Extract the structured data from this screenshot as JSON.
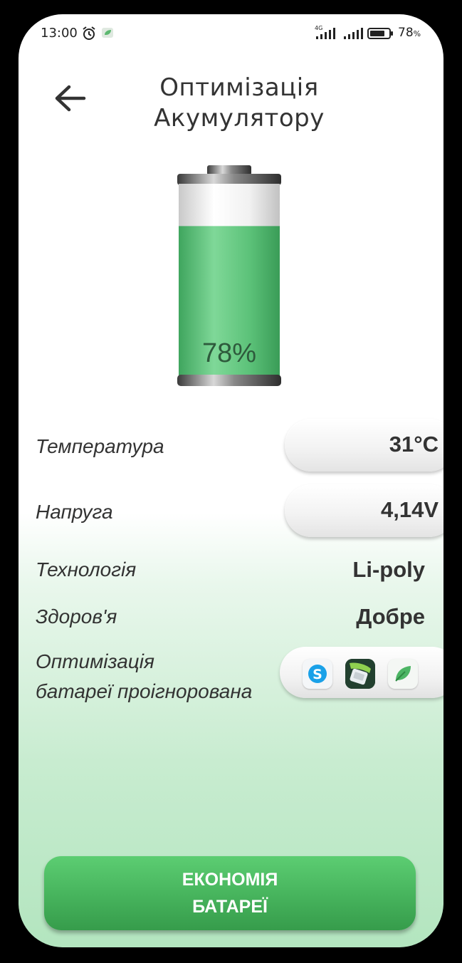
{
  "status_bar": {
    "time": "13:00",
    "network": "4G",
    "battery_percent": "78",
    "battery_percent_sign": "%",
    "icons": [
      "alarm-icon",
      "notification-app-icon",
      "signal-4g-icon",
      "signal-icon",
      "battery-icon"
    ]
  },
  "header": {
    "back_icon": "arrow-left-icon",
    "title_line1": "Оптимізація",
    "title_line2": "Акумулятору"
  },
  "battery": {
    "percent_label": "78%",
    "level": 0.78,
    "fill_color": "#5cc279"
  },
  "info": {
    "temperature_label": "Температура",
    "temperature_value": "31°C",
    "voltage_label": "Напруга",
    "voltage_value": "4,14V",
    "technology_label": "Технологія",
    "technology_value": "Li-poly",
    "health_label": "Здоров'я",
    "health_value": "Добре",
    "ignored_label_line1": "Оптимізація",
    "ignored_label_line2": "батареї проігнорована",
    "ignored_apps": [
      "skype-icon",
      "charger-app-icon",
      "leaf-app-icon"
    ]
  },
  "economy_button": {
    "label": "ЕКОНОМІЯ\nБАТАРЕЇ"
  },
  "colors": {
    "accent_green": "#46b35c",
    "text": "#333333"
  }
}
